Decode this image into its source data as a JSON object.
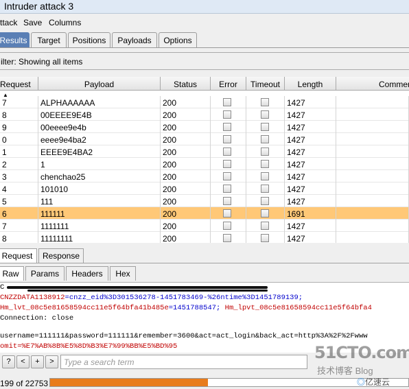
{
  "window": {
    "title": "Intruder attack 3"
  },
  "menu": [
    "ttack",
    "Save",
    "Columns"
  ],
  "tabs": [
    "Results",
    "Target",
    "Positions",
    "Payloads",
    "Options"
  ],
  "filter": {
    "text": "ilter: Showing all items"
  },
  "table": {
    "columns": [
      "Request",
      "Payload",
      "Status",
      "Error",
      "Timeout",
      "Length",
      "Commen"
    ],
    "rows": [
      {
        "request": "7",
        "payload": "ALPHAAAAAA",
        "status": "200",
        "length": "1427",
        "selected": false
      },
      {
        "request": "8",
        "payload": "00EEEE9E4B",
        "status": "200",
        "length": "1427",
        "selected": false
      },
      {
        "request": "9",
        "payload": "00eeee9e4b",
        "status": "200",
        "length": "1427",
        "selected": false
      },
      {
        "request": "0",
        "payload": "eeee9e4ba2",
        "status": "200",
        "length": "1427",
        "selected": false
      },
      {
        "request": "1",
        "payload": "EEEE9E4BA2",
        "status": "200",
        "length": "1427",
        "selected": false
      },
      {
        "request": "2",
        "payload": "1",
        "status": "200",
        "length": "1427",
        "selected": false
      },
      {
        "request": "3",
        "payload": "chenchao25",
        "status": "200",
        "length": "1427",
        "selected": false
      },
      {
        "request": "4",
        "payload": "101010",
        "status": "200",
        "length": "1427",
        "selected": false
      },
      {
        "request": "5",
        "payload": "111",
        "status": "200",
        "length": "1427",
        "selected": false
      },
      {
        "request": "6",
        "payload": "111111",
        "status": "200",
        "length": "1691",
        "selected": true
      },
      {
        "request": "7",
        "payload": "1111111",
        "status": "200",
        "length": "1427",
        "selected": false
      },
      {
        "request": "8",
        "payload": "11111111",
        "status": "200",
        "length": "1427",
        "selected": false
      }
    ]
  },
  "reqresp_tabs": [
    "Request",
    "Response"
  ],
  "view_tabs": [
    "Raw",
    "Params",
    "Headers",
    "Hex"
  ],
  "editor": {
    "line1": "C",
    "line2_key": "CNZZDATA1138912",
    "line2_val": "=cnzz_eid%3D301536278-1451783469-%26ntime%3D1451789139;",
    "line3_key": "Hm_lvt_08c5e81658594cc11e5f64bfa41b485e",
    "line3_mid": "=1451788547; ",
    "line3_key2": "Hm_lpvt_08c5e81658594cc11e5f64bfa4",
    "line4": "Connection: close",
    "line5": "username=111111&password=111111&remember=3600&act=act_login&back_act=http%3A%2F%2Fwww",
    "line6": "omit=%E7%AB%8B%E5%8D%B3%E7%99%BB%E5%BD%95"
  },
  "search": {
    "buttons": [
      "?",
      "<",
      "+",
      ">"
    ],
    "placeholder": "Type a search term"
  },
  "status": {
    "text": "199 of 22753",
    "progress": 0.44
  },
  "watermark": {
    "main": "51CTO.com",
    "sub": "技术博客 Blog",
    "brand": "亿速云"
  }
}
